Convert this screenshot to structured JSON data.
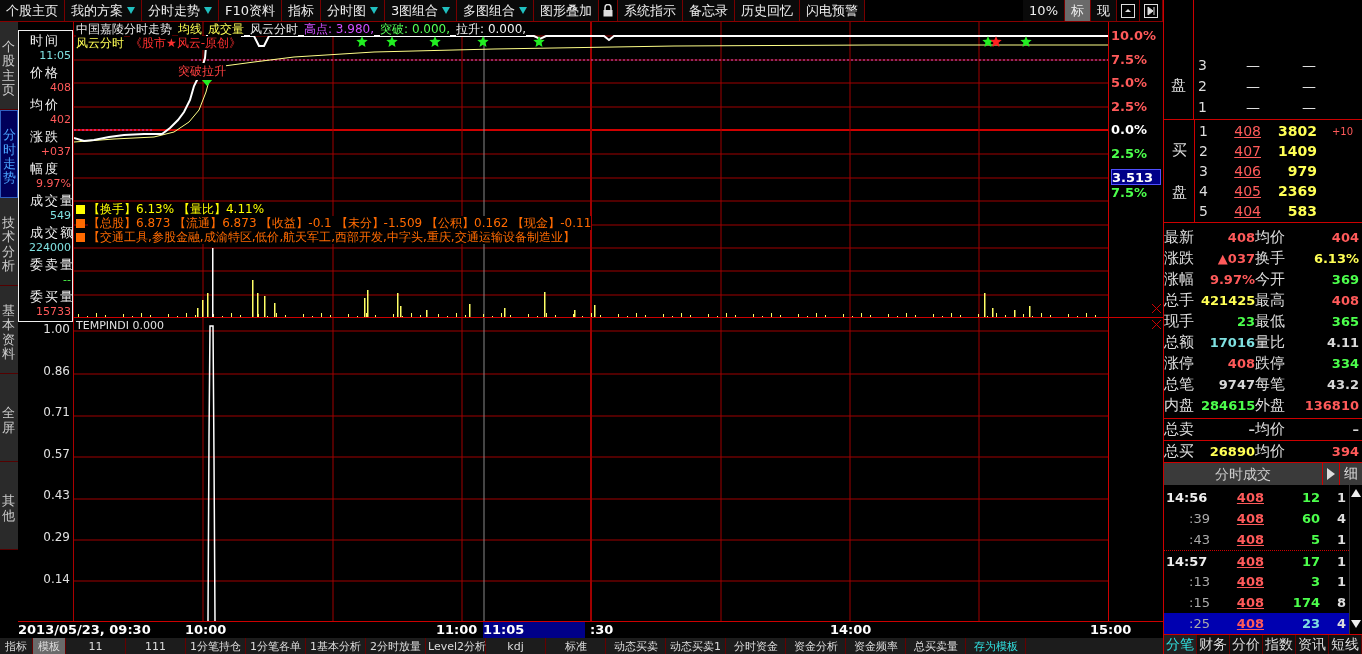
{
  "toolbar": {
    "items": [
      {
        "kind": "text",
        "label": "个股主页",
        "dropdown": false
      },
      {
        "kind": "text",
        "label": "我的方案",
        "dropdown": true
      },
      {
        "kind": "text",
        "label": "分时走势",
        "dropdown": true
      },
      {
        "kind": "text",
        "label": "F10资料",
        "dropdown": false
      },
      {
        "kind": "text",
        "label": "指标",
        "dropdown": false
      },
      {
        "kind": "text",
        "label": "分时图",
        "dropdown": true
      },
      {
        "kind": "text",
        "label": "3图组合",
        "dropdown": true
      },
      {
        "kind": "text",
        "label": "多图组合",
        "dropdown": true
      },
      {
        "kind": "text",
        "label": "图形叠加",
        "dropdown": false
      },
      {
        "kind": "lock"
      },
      {
        "kind": "text",
        "label": "系统指示",
        "dropdown": false
      },
      {
        "kind": "text",
        "label": "备忘录",
        "dropdown": false
      },
      {
        "kind": "text",
        "label": "历史回忆",
        "dropdown": false
      },
      {
        "kind": "text",
        "label": "闪电预警",
        "dropdown": false
      }
    ],
    "right_buttons": [
      {
        "label": "10%",
        "selected": false
      },
      {
        "label": "标",
        "selected": true
      },
      {
        "label": "现",
        "selected": false
      }
    ]
  },
  "side_tabs": [
    {
      "label": "个股主页",
      "selected": false
    },
    {
      "label": "分时走势",
      "selected": true
    },
    {
      "label": "技术分析",
      "selected": false
    },
    {
      "label": "基本资料",
      "selected": false
    },
    {
      "label": "全屏",
      "selected": false
    },
    {
      "label": "其他",
      "selected": false
    }
  ],
  "chart": {
    "header": [
      [
        {
          "text": "中国嘉陵分时走势",
          "kind": "title"
        },
        {
          "text": "均线",
          "kind": "accent"
        },
        {
          "text": "成交量",
          "kind": "accent"
        },
        {
          "text": "风云分时",
          "kind": "title"
        },
        {
          "text": "高点: 3.980,",
          "kind": "high"
        },
        {
          "text": "突破: 0.000,",
          "kind": "breakout"
        },
        {
          "text": "拉升: 0.000,",
          "kind": "lift"
        }
      ],
      [
        {
          "text": "风云分时",
          "kind": "accent"
        },
        {
          "text": "《股市★风云-原创》",
          "kind": "signature"
        }
      ]
    ],
    "annotation": "突破拉升",
    "legend": [
      {
        "text": "【换手】6.13% 【量比】4.11%",
        "color": "#ffff00"
      },
      {
        "text": "【总股】6.873 【流通】6.873 【收益】-0.1 【未分】-1.509 【公积】0.162 【现金】-0.11",
        "color": "#ff6a00"
      },
      {
        "text": "【交通工具,参股金融,成渝特区,低价,航天军工,西部开发,中字头,重庆,交通运输设备制造业】",
        "color": "#ff6a00"
      }
    ],
    "right_axis": [
      {
        "text": "10.0%",
        "kind": "up"
      },
      {
        "text": "7.5%",
        "kind": "up"
      },
      {
        "text": "5.0%",
        "kind": "up"
      },
      {
        "text": "2.5%",
        "kind": "up"
      },
      {
        "text": "0.0%",
        "kind": "zero"
      },
      {
        "text": "2.5%",
        "kind": "down"
      },
      {
        "text": "3.513",
        "kind": "cursor"
      },
      {
        "text": "7.5%",
        "kind": "down"
      }
    ],
    "indicator": {
      "title": "TEMPINDI 0.000",
      "axis": [
        "1.00",
        "0.86",
        "0.71",
        "0.57",
        "0.43",
        "0.29",
        "0.14"
      ]
    },
    "time_axis": [
      {
        "text": "2013/05/23, 09:30",
        "kind": "plain"
      },
      {
        "text": "10:00",
        "kind": "plain"
      },
      {
        "text": "11:00",
        "kind": "plain"
      },
      {
        "text": "11:05",
        "kind": "cursor"
      },
      {
        "text": ":30",
        "kind": "plain"
      },
      {
        "text": "14:00",
        "kind": "plain"
      },
      {
        "text": "15:00",
        "kind": "plain"
      }
    ]
  },
  "info_panel": [
    {
      "label": "时间",
      "value": "11:05",
      "kind": "info"
    },
    {
      "label": "价格",
      "value": "408",
      "kind": "up"
    },
    {
      "label": "均价",
      "value": "402",
      "kind": "up"
    },
    {
      "label": "涨跌",
      "value": "+037",
      "kind": "up"
    },
    {
      "label": "幅度",
      "value": "9.97%",
      "kind": "up"
    },
    {
      "label": "成交量",
      "value": "549",
      "kind": "info"
    },
    {
      "label": "成交额",
      "value": "224000",
      "kind": "info"
    },
    {
      "label": "委卖量",
      "value": "--",
      "kind": "down"
    },
    {
      "label": "委买量",
      "value": "15733",
      "kind": "up"
    }
  ],
  "quote": {
    "sell_label": "盘",
    "sell": [
      {
        "rank": "3",
        "price": "—",
        "volume": "—"
      },
      {
        "rank": "2",
        "price": "—",
        "volume": "—"
      },
      {
        "rank": "1",
        "price": "—",
        "volume": "—"
      }
    ],
    "buy_label": "买盘",
    "buy": [
      {
        "rank": "1",
        "price": "408",
        "volume": "3802",
        "change": "+10"
      },
      {
        "rank": "2",
        "price": "407",
        "volume": "1409"
      },
      {
        "rank": "3",
        "price": "406",
        "volume": "979"
      },
      {
        "rank": "4",
        "price": "405",
        "volume": "2369"
      },
      {
        "rank": "5",
        "price": "404",
        "volume": "583"
      }
    ],
    "stats": [
      [
        {
          "label": "最新",
          "value": "408",
          "kind": "up"
        },
        {
          "label": "均价",
          "value": "404",
          "kind": "up"
        }
      ],
      [
        {
          "label": "涨跌",
          "value": "▲037",
          "kind": "up"
        },
        {
          "label": "换手",
          "value": "6.13%",
          "kind": "vol"
        }
      ],
      [
        {
          "label": "涨幅",
          "value": "9.97%",
          "kind": "up"
        },
        {
          "label": "今开",
          "value": "369",
          "kind": "down"
        }
      ],
      [
        {
          "label": "总手",
          "value": "421425",
          "kind": "vol"
        },
        {
          "label": "最高",
          "value": "408",
          "kind": "up"
        }
      ],
      [
        {
          "label": "现手",
          "value": "23",
          "kind": "down"
        },
        {
          "label": "最低",
          "value": "365",
          "kind": "down"
        }
      ],
      [
        {
          "label": "总额",
          "value": "17016",
          "kind": "info"
        },
        {
          "label": "量比",
          "value": "4.11",
          "kind": "plain"
        }
      ],
      [
        {
          "label": "涨停",
          "value": "408",
          "kind": "up"
        },
        {
          "label": "跌停",
          "value": "334",
          "kind": "down"
        }
      ],
      [
        {
          "label": "总笔",
          "value": "9747",
          "kind": "plain"
        },
        {
          "label": "每笔",
          "value": "43.2",
          "kind": "plain"
        }
      ],
      [
        {
          "label": "内盘",
          "value": "284615",
          "kind": "down"
        },
        {
          "label": "外盘",
          "value": "136810",
          "kind": "up"
        }
      ]
    ],
    "totals": [
      [
        {
          "label": "总卖",
          "value": "–",
          "kind": "plain"
        },
        {
          "label": "均价",
          "value": "–",
          "kind": "plain"
        }
      ],
      [
        {
          "label": "总买",
          "value": "26890",
          "kind": "vol"
        },
        {
          "label": "均价",
          "value": "394",
          "kind": "up"
        }
      ]
    ],
    "trades": {
      "title": "分时成交",
      "detail": "细",
      "rows": [
        {
          "time": "14:56",
          "kind": "minute",
          "price": "408",
          "volume": "12",
          "count": "1",
          "selected": false
        },
        {
          "time": ":39",
          "kind": "second",
          "price": "408",
          "volume": "60",
          "count": "4",
          "selected": false
        },
        {
          "time": ":43",
          "kind": "second",
          "price": "408",
          "volume": "5",
          "count": "1",
          "selected": false
        },
        {
          "time": "14:57",
          "kind": "minute",
          "price": "408",
          "volume": "17",
          "count": "1",
          "selected": false
        },
        {
          "time": ":13",
          "kind": "second",
          "price": "408",
          "volume": "3",
          "count": "1",
          "selected": false
        },
        {
          "time": ":15",
          "kind": "second",
          "price": "408",
          "volume": "174",
          "count": "8",
          "selected": false
        },
        {
          "time": ":25",
          "kind": "second",
          "price": "408",
          "volume": "23",
          "count": "4",
          "selected": true
        }
      ]
    },
    "tabs": [
      {
        "label": "分笔",
        "selected": true
      },
      {
        "label": "财务",
        "selected": false
      },
      {
        "label": "分价",
        "selected": false
      },
      {
        "label": "指数",
        "selected": false
      },
      {
        "label": "资讯",
        "selected": false
      },
      {
        "label": "短线",
        "selected": false
      }
    ]
  },
  "bottom_tabs": [
    {
      "label": "指标",
      "kind": "tab",
      "selected": false
    },
    {
      "label": "模板",
      "kind": "tab",
      "selected": true
    },
    {
      "label": "11",
      "kind": "tab",
      "selected": false
    },
    {
      "label": "111",
      "kind": "tab",
      "selected": false
    },
    {
      "label": "1分笔持仓",
      "kind": "tab",
      "selected": false
    },
    {
      "label": "1分笔各单",
      "kind": "tab",
      "selected": false
    },
    {
      "label": "1基本分析",
      "kind": "tab",
      "selected": false
    },
    {
      "label": "2分时放量",
      "kind": "tab",
      "selected": false
    },
    {
      "label": "Level2分析",
      "kind": "tab",
      "selected": false
    },
    {
      "label": "kdj",
      "kind": "tab",
      "selected": false
    },
    {
      "label": "标准",
      "kind": "tab",
      "selected": false
    },
    {
      "label": "动态买卖",
      "kind": "tab",
      "selected": false
    },
    {
      "label": "动态买卖1",
      "kind": "tab",
      "selected": false
    },
    {
      "label": "分时资金",
      "kind": "tab",
      "selected": false
    },
    {
      "label": "资金分析",
      "kind": "tab",
      "selected": false
    },
    {
      "label": "资金频率",
      "kind": "tab",
      "selected": false
    },
    {
      "label": "总买卖量",
      "kind": "tab",
      "selected": false
    },
    {
      "label": "存为模板",
      "kind": "action",
      "selected": false
    }
  ]
}
